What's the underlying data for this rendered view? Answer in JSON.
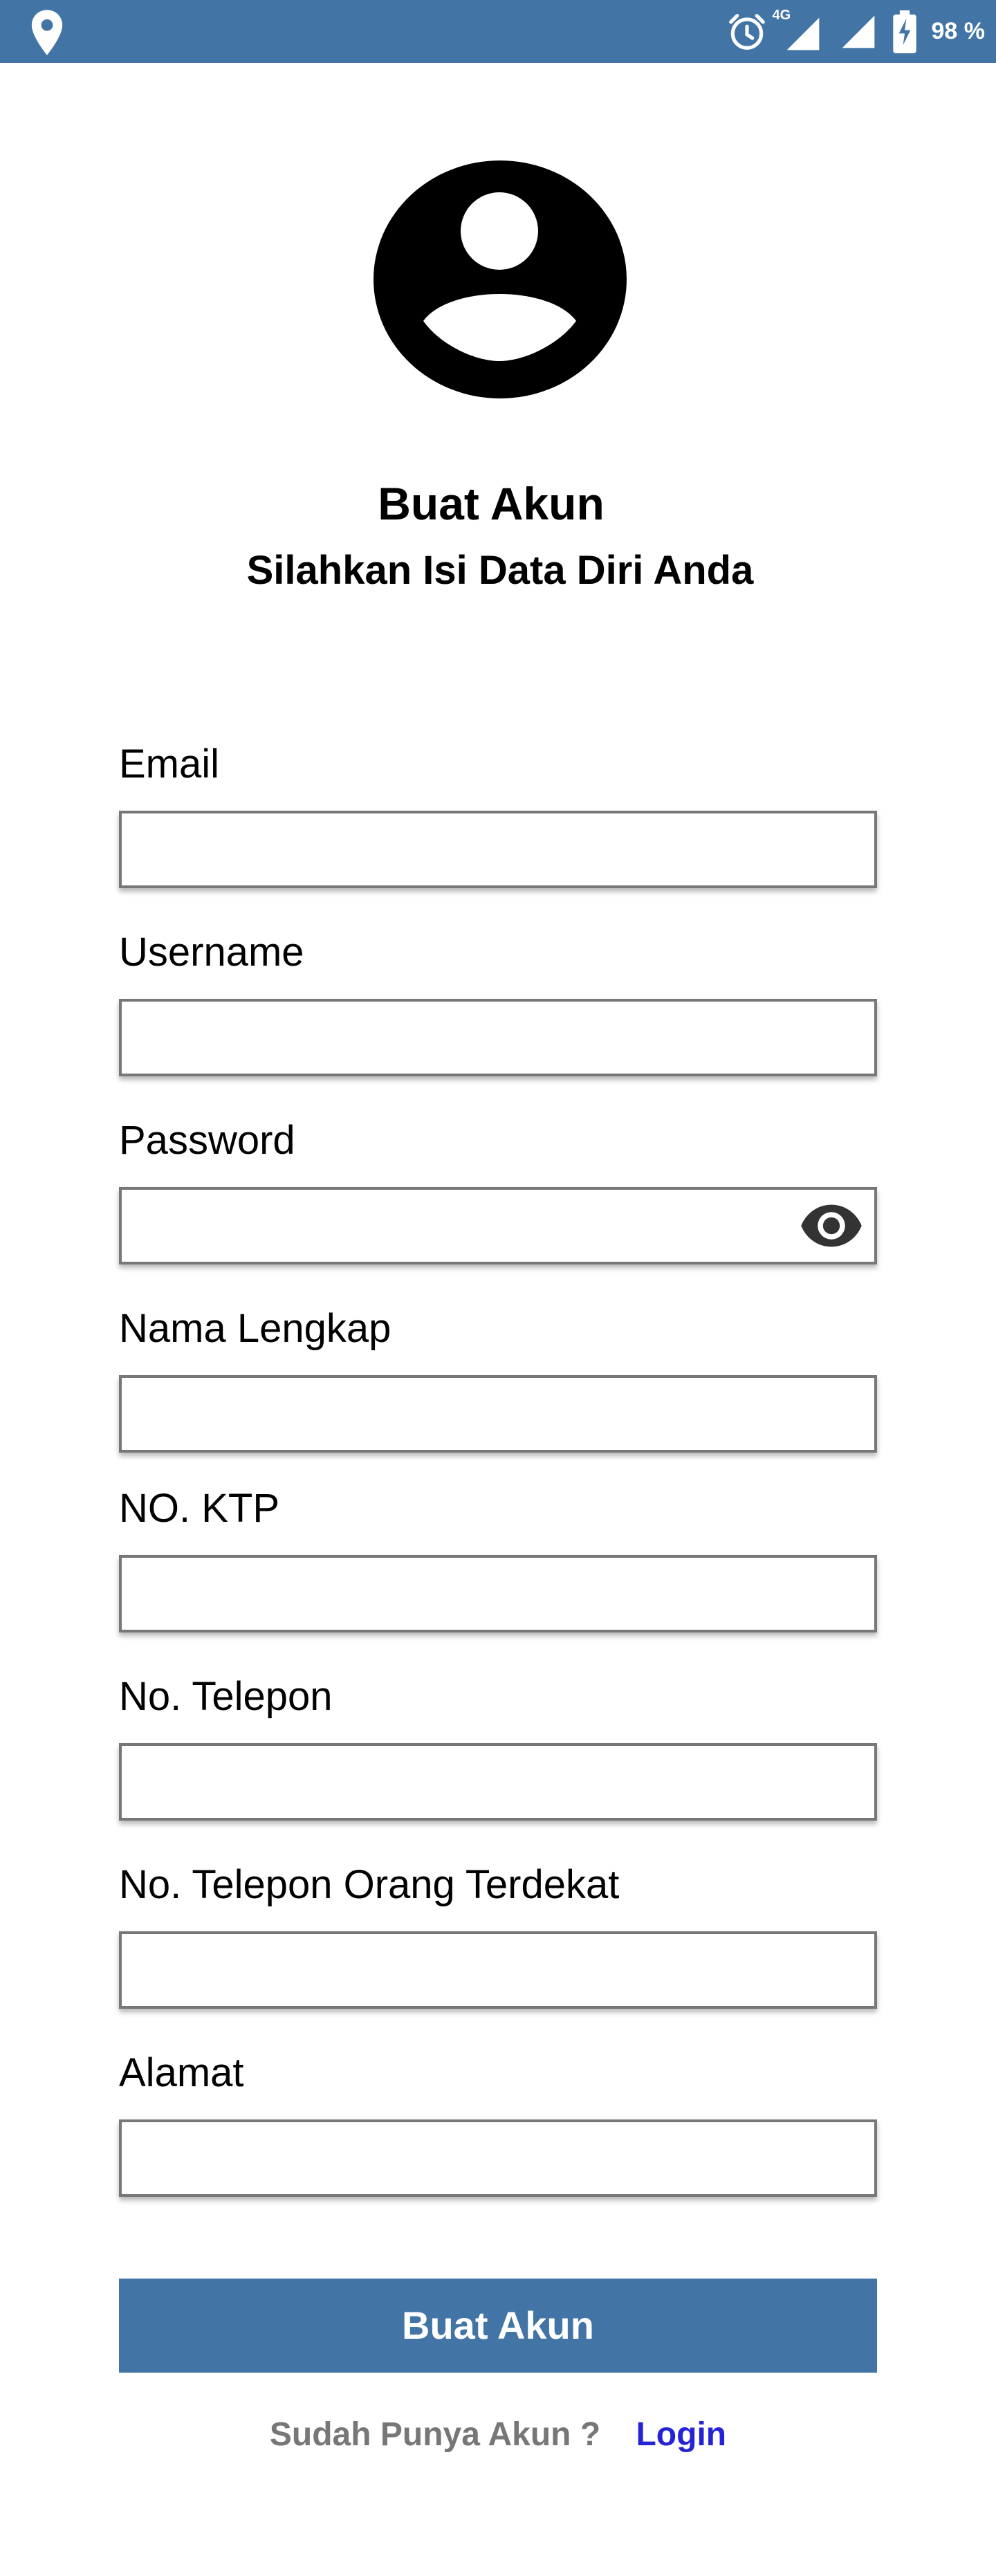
{
  "status_bar": {
    "background_color": "#4274A5",
    "left_icon": "location-pin-icon",
    "right_icons": [
      "alarm-clock-icon",
      "signal-4g-icon",
      "signal-icon",
      "battery-charging-icon"
    ],
    "network_label": "4G",
    "battery_percent": "98 %"
  },
  "header": {
    "avatar_icon": "account-circle-icon",
    "title": "Buat Akun",
    "subtitle": "Silahkan Isi Data Diri Anda"
  },
  "form": {
    "fields": [
      {
        "label": "Email",
        "value": "",
        "type": "email"
      },
      {
        "label": "Username",
        "value": "",
        "type": "text"
      },
      {
        "label": "Password",
        "value": "",
        "type": "password",
        "toggle_icon": "eye-icon"
      },
      {
        "label": "Nama Lengkap",
        "value": "",
        "type": "text"
      },
      {
        "label": "NO. KTP",
        "value": "",
        "type": "text"
      },
      {
        "label": "No. Telepon",
        "value": "",
        "type": "tel"
      },
      {
        "label": "No. Telepon Orang Terdekat",
        "value": "",
        "type": "tel"
      },
      {
        "label": "Alamat",
        "value": "",
        "type": "text"
      }
    ],
    "submit_label": "Buat Akun",
    "submit_color": "#4274A5"
  },
  "footer": {
    "question": "Sudah Punya Akun ?",
    "login_label": "Login",
    "login_color": "#2424D6"
  }
}
